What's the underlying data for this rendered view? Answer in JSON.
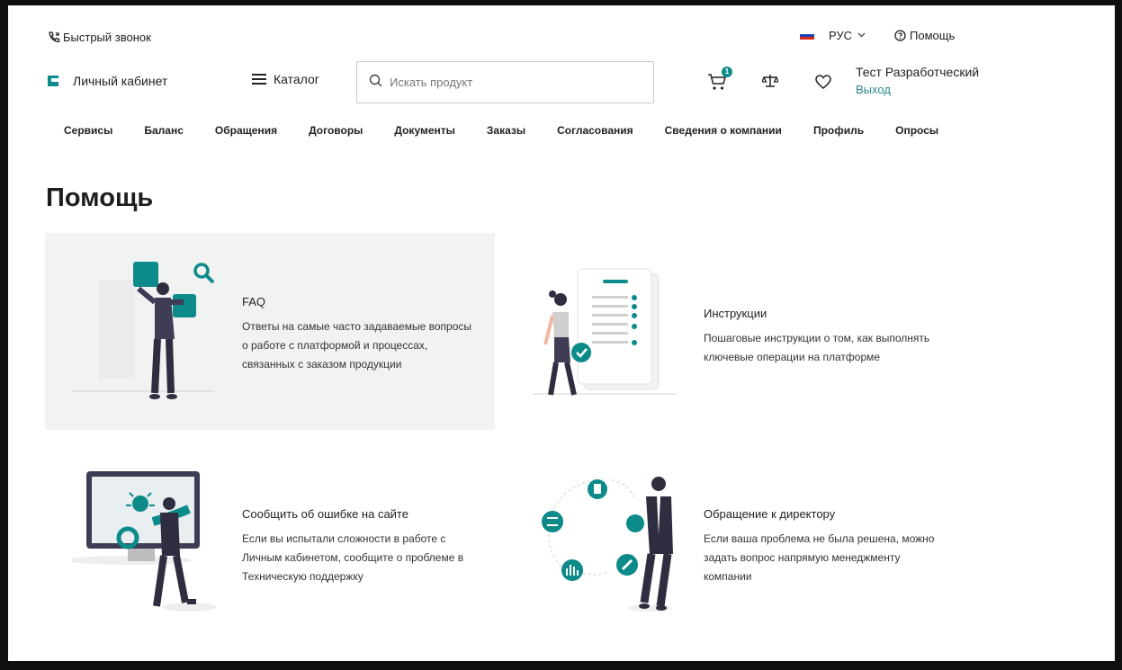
{
  "topbar": {
    "callback": "Быстрый звонок",
    "language": "РУС",
    "help": "Помощь"
  },
  "header": {
    "cabinet": "Личный кабинет",
    "catalog": "Каталог",
    "search_placeholder": "Искать продукт",
    "cart_count": "1",
    "user_name": "Тест Разработческий",
    "logout": "Выход"
  },
  "nav": {
    "items": [
      "Сервисы",
      "Баланс",
      "Обращения",
      "Договоры",
      "Документы",
      "Заказы",
      "Согласования",
      "Сведения о компании",
      "Профиль",
      "Опросы"
    ]
  },
  "page_title": "Помощь",
  "cards": [
    {
      "title": "FAQ",
      "desc_lines": [
        "Ответы на самые часто задаваемые вопросы",
        "о работе с платформой и процессах,",
        "связанных с заказом продукции"
      ]
    },
    {
      "title": "Инструкции",
      "desc_lines": [
        "Пошаговые инструкции о том, как выполнять",
        "ключевые операции на платформе"
      ]
    },
    {
      "title": "Сообщить об ошибке на сайте",
      "desc_lines": [
        "Если вы испытали сложности в работе с",
        "Личным кабинетом, сообщите о проблеме в",
        "Техническую поддержку"
      ]
    },
    {
      "title": "Обращение к директору",
      "desc_lines": [
        "Если ваша проблема не была решена, можно",
        "задать вопрос напрямую менеджменту",
        "компании"
      ]
    }
  ],
  "colors": {
    "accent": "#0d8a8a",
    "card_active_bg": "#f1f2f2",
    "flag_white": "#ffffff",
    "flag_blue": "#1f3fb5",
    "flag_red": "#d52b1e"
  },
  "icons": {
    "callback": "phone-icon",
    "help": "question-circle-icon",
    "search": "search-icon",
    "cart": "cart-icon",
    "compare": "scales-icon",
    "favorite": "heart-icon"
  }
}
